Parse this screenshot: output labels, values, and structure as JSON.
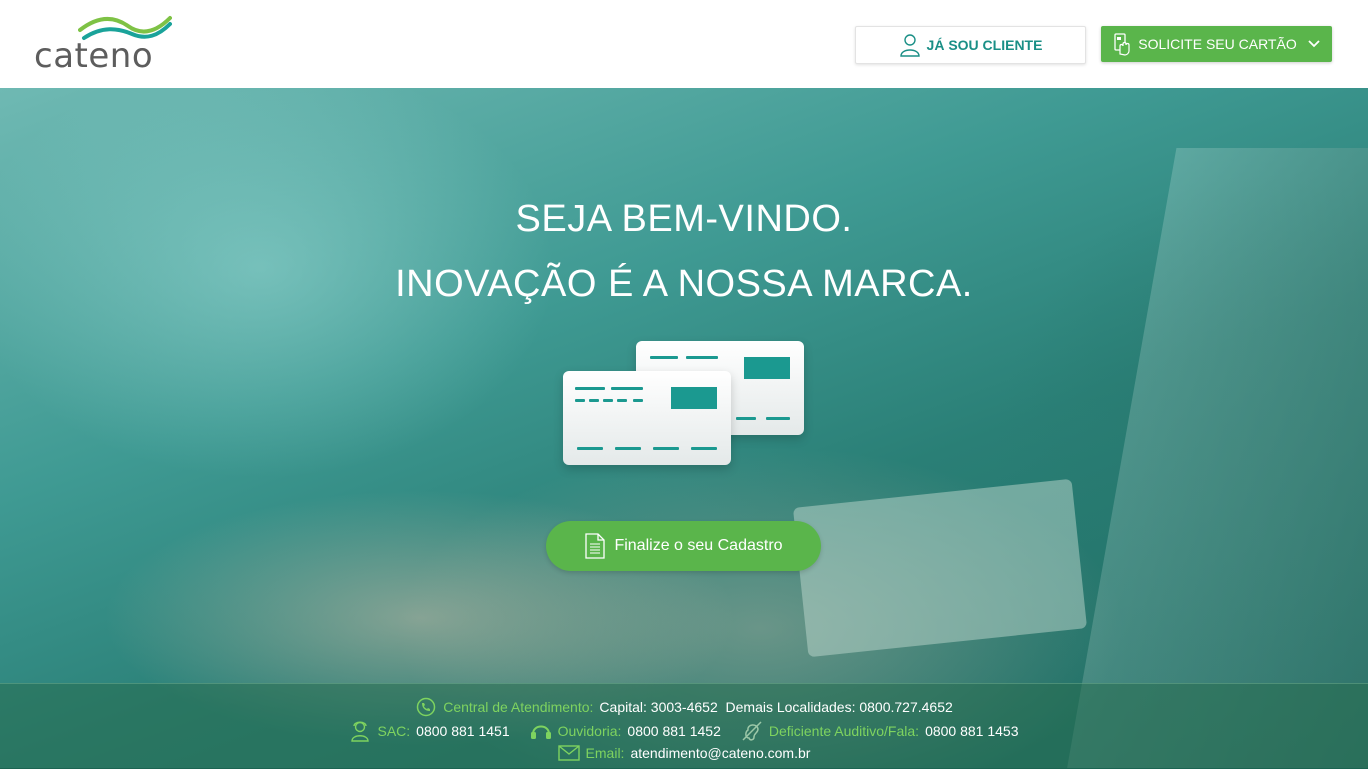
{
  "header": {
    "logo_text": "cateno",
    "client_button": "JÁ SOU CLIENTE",
    "card_button": "SOLICITE SEU CARTÃO"
  },
  "hero": {
    "headline_1": "SEJA BEM-VINDO.",
    "headline_2": "INOVAÇÃO É A NOSSA MARCA.",
    "cta_label": "Finalize o seu Cadastro"
  },
  "footer": {
    "central": {
      "label": "Central de Atendimento:",
      "value": "Capital: 3003-4652  Demais Localidades: 0800.727.4652"
    },
    "sac": {
      "label": "SAC:",
      "value": "0800 881 1451"
    },
    "ouvidoria": {
      "label": "Ouvidoria:",
      "value": "0800 881 1452"
    },
    "deficiente": {
      "label": "Deficiente Auditivo/Fala:",
      "value": "0800 881 1453"
    },
    "email": {
      "label": "Email:",
      "value": "atendimento@cateno.com.br"
    }
  },
  "colors": {
    "brand_green": "#5ab54b",
    "brand_teal": "#1a8f86",
    "label_green": "#7ed35f"
  },
  "icons": [
    "user-icon",
    "card-hand-icon",
    "chevron-down-icon",
    "document-icon",
    "phone-icon",
    "agent-icon",
    "headset-icon",
    "ear-icon",
    "envelope-icon"
  ]
}
